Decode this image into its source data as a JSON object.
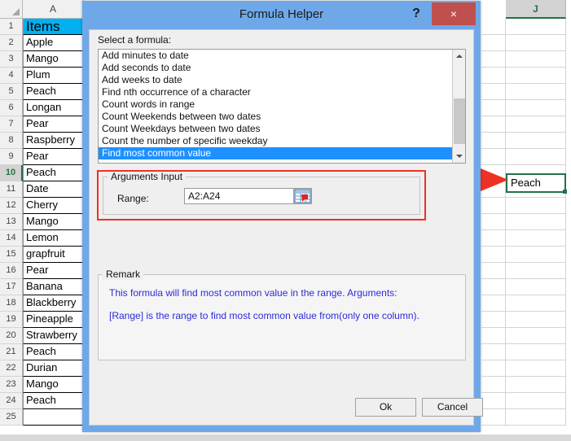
{
  "spreadsheet": {
    "column_headers": [
      "A",
      "J"
    ],
    "corner_icon": "select-all-triangle-icon",
    "selected_column": "J",
    "selected_row": "10",
    "column_a": {
      "header_cell": "Items",
      "header_fill": "#00b0f0",
      "rows": [
        {
          "num": "1",
          "value": "Items"
        },
        {
          "num": "2",
          "value": "Apple"
        },
        {
          "num": "3",
          "value": "Mango"
        },
        {
          "num": "4",
          "value": "Plum"
        },
        {
          "num": "5",
          "value": "Peach"
        },
        {
          "num": "6",
          "value": "Longan"
        },
        {
          "num": "7",
          "value": "Pear"
        },
        {
          "num": "8",
          "value": "Raspberry"
        },
        {
          "num": "9",
          "value": "Pear"
        },
        {
          "num": "10",
          "value": "Peach"
        },
        {
          "num": "11",
          "value": "Date"
        },
        {
          "num": "12",
          "value": "Cherry"
        },
        {
          "num": "13",
          "value": "Mango"
        },
        {
          "num": "14",
          "value": "Lemon"
        },
        {
          "num": "15",
          "value": "grapfruit"
        },
        {
          "num": "16",
          "value": "Pear"
        },
        {
          "num": "17",
          "value": "Banana"
        },
        {
          "num": "18",
          "value": "Blackberry"
        },
        {
          "num": "19",
          "value": "Pineapple"
        },
        {
          "num": "20",
          "value": "Strawberry"
        },
        {
          "num": "21",
          "value": "Peach"
        },
        {
          "num": "22",
          "value": "Durian"
        },
        {
          "num": "23",
          "value": "Mango"
        },
        {
          "num": "24",
          "value": "Peach"
        },
        {
          "num": "25",
          "value": ""
        }
      ]
    },
    "result_cell": {
      "value": "Peach",
      "border_color": "#217346"
    }
  },
  "annotation": {
    "arrow_color": "#ee3124",
    "arrow_name": "red-pointer-arrow",
    "highlight_box_color": "#ee3124"
  },
  "dialog": {
    "title": "Formula Helper",
    "help_label": "?",
    "close_label": "×",
    "titlebar_color": "#6fa8e8",
    "close_color": "#c0504d",
    "select_formula_label": "Select a formula:",
    "formula_list": [
      {
        "label": "Add minutes to date",
        "selected": false
      },
      {
        "label": "Add seconds to date",
        "selected": false
      },
      {
        "label": "Add weeks to date",
        "selected": false
      },
      {
        "label": "Find nth occurrence of a character",
        "selected": false
      },
      {
        "label": "Count words in range",
        "selected": false
      },
      {
        "label": "Count Weekends between two dates",
        "selected": false
      },
      {
        "label": "Count Weekdays between two dates",
        "selected": false
      },
      {
        "label": "Count the number of specific weekday",
        "selected": false
      },
      {
        "label": "Find most common value",
        "selected": true
      }
    ],
    "selection_color": "#1e90ff",
    "arguments": {
      "legend": "Arguments Input",
      "range_label": "Range:",
      "range_value": "A2:A24",
      "range_placeholder": "",
      "picker_icon": "range-picker-icon"
    },
    "remark": {
      "legend": "Remark",
      "lines": [
        "This formula will find most common value in the range. Arguments:",
        "[Range] is the range to find most common value from(only one column)."
      ],
      "text_color": "#2b2bdd"
    },
    "buttons": {
      "ok": "Ok",
      "cancel": "Cancel"
    }
  }
}
